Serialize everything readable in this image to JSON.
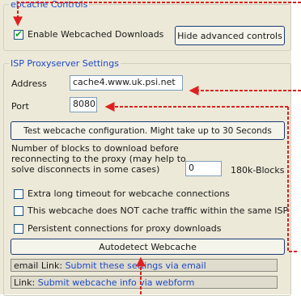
{
  "webcache_controls": {
    "legend": "ebcache Controls",
    "enable_label": "Enable Webcached Downloads",
    "enable_checked": true,
    "hide_advanced_button": "Hide advanced controls"
  },
  "isp_proxy": {
    "legend": "ISP Proxyserver Settings",
    "address_label": "Address",
    "address_value": "cache4.www.uk.psi.net",
    "port_label": "Port",
    "port_value": "8080",
    "test_button": "Test webcache configuration. Might take up to 30 Seconds",
    "blocks_text_line1": "Number of blocks to download before",
    "blocks_text_line2": "reconnecting to the proxy (may help to",
    "blocks_text_line3": "solve disconnects in some cases)",
    "blocks_value": "0",
    "blocks_unit": "180k-Blocks",
    "options": [
      {
        "label": "Extra long timeout for webcache connections",
        "checked": false
      },
      {
        "label": "This webcache does NOT cache traffic within the same ISP",
        "checked": false
      },
      {
        "label": "Persistent connections for proxy downloads",
        "checked": false
      }
    ],
    "autodetect_button": "Autodetect Webcache",
    "email_prefix": "email Link:",
    "email_link": "Submit these settings via email",
    "web_prefix": "Link:",
    "web_link": "Submit webcache info via webform"
  },
  "colors": {
    "annotation_red": "#e02020",
    "legend_blue": "#1f49c6"
  }
}
